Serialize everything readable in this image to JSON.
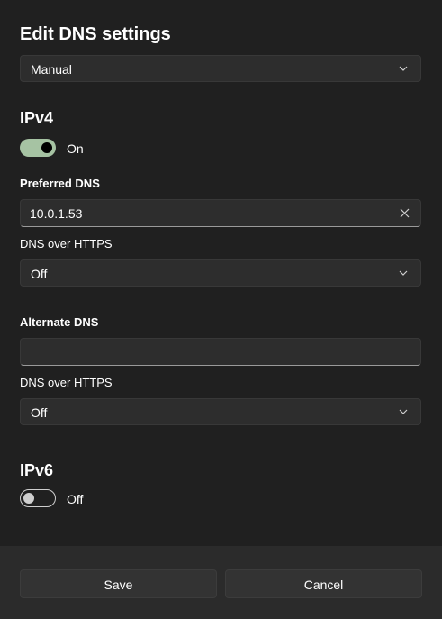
{
  "dialog": {
    "title": "Edit DNS settings",
    "mode_value": "Manual"
  },
  "ipv4": {
    "title": "IPv4",
    "toggle_state": "On",
    "preferred_label": "Preferred DNS",
    "preferred_value": "10.0.1.53",
    "preferred_https_label": "DNS over HTTPS",
    "preferred_https_value": "Off",
    "alternate_label": "Alternate DNS",
    "alternate_value": "",
    "alternate_https_label": "DNS over HTTPS",
    "alternate_https_value": "Off"
  },
  "ipv6": {
    "title": "IPv6",
    "toggle_state": "Off"
  },
  "footer": {
    "save_label": "Save",
    "cancel_label": "Cancel"
  },
  "icons": {
    "dropdown": "chevron-down-icon",
    "clear": "close-icon"
  },
  "colors": {
    "background": "#202020",
    "footer": "#2b2b2b",
    "control": "#2d2d2d",
    "toggle_on": "#a6c3a3",
    "button": "#333333"
  }
}
